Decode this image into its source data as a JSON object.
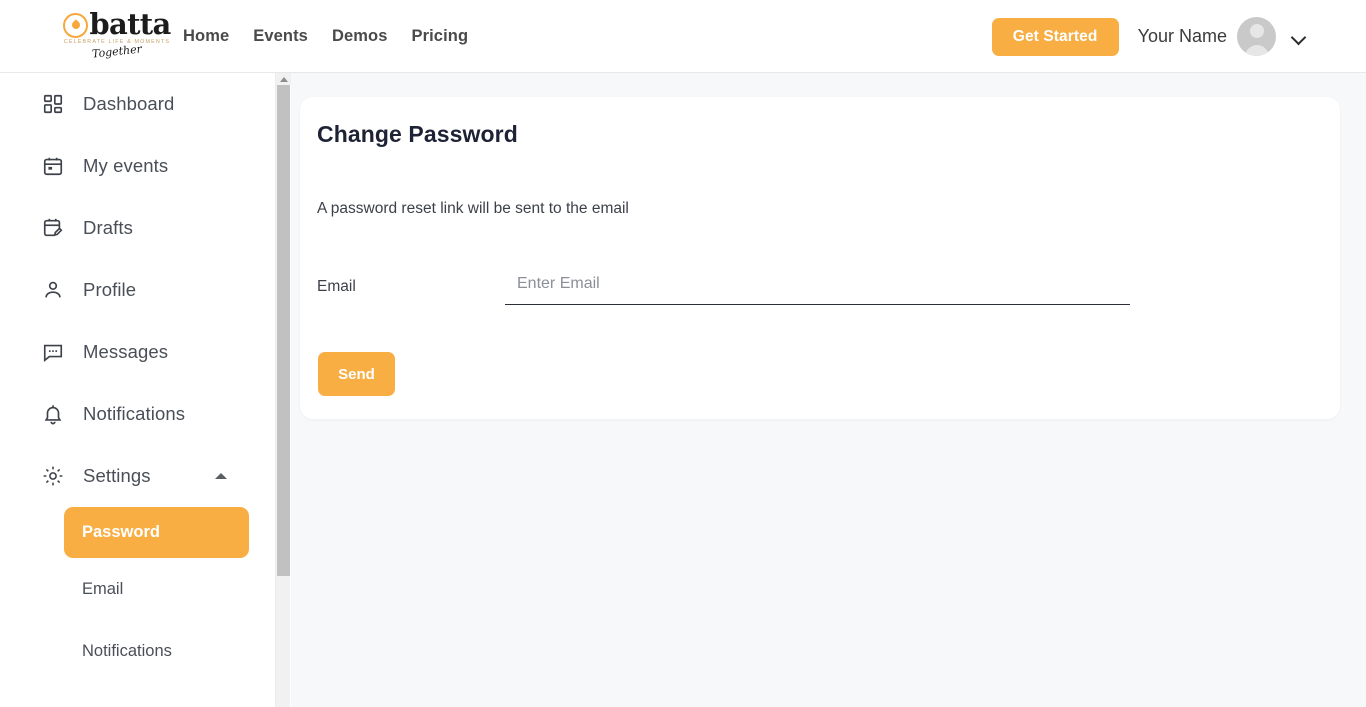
{
  "header": {
    "logo": {
      "word": "batta",
      "tagline": "CELEBRATE LIFE & MOMENTS",
      "script": "Together"
    },
    "nav": [
      {
        "label": "Home"
      },
      {
        "label": "Events"
      },
      {
        "label": "Demos"
      },
      {
        "label": "Pricing"
      }
    ],
    "get_started_label": "Get Started",
    "user_name": "Your Name"
  },
  "sidebar": {
    "items": [
      {
        "label": "Dashboard",
        "icon": "dashboard-grid-icon"
      },
      {
        "label": "My events",
        "icon": "calendar-icon"
      },
      {
        "label": "Drafts",
        "icon": "calendar-edit-icon"
      },
      {
        "label": "Profile",
        "icon": "person-icon"
      },
      {
        "label": "Messages",
        "icon": "chat-bubble-icon"
      },
      {
        "label": "Notifications",
        "icon": "bell-icon"
      },
      {
        "label": "Settings",
        "icon": "gear-icon"
      }
    ],
    "settings_subitems": [
      {
        "label": "Password",
        "active": true
      },
      {
        "label": "Email",
        "active": false
      },
      {
        "label": "Notifications",
        "active": false
      }
    ]
  },
  "main": {
    "title": "Change Password",
    "description": "A password reset link will be sent to the email",
    "email_label": "Email",
    "email_value": "",
    "email_placeholder": "Enter Email",
    "send_label": "Send"
  },
  "colors": {
    "accent": "#f8ae43",
    "content_bg": "#f6f8fa",
    "card_bg": "#ffffff",
    "text_dark": "#1e2235",
    "text_body": "#4a4f57"
  }
}
